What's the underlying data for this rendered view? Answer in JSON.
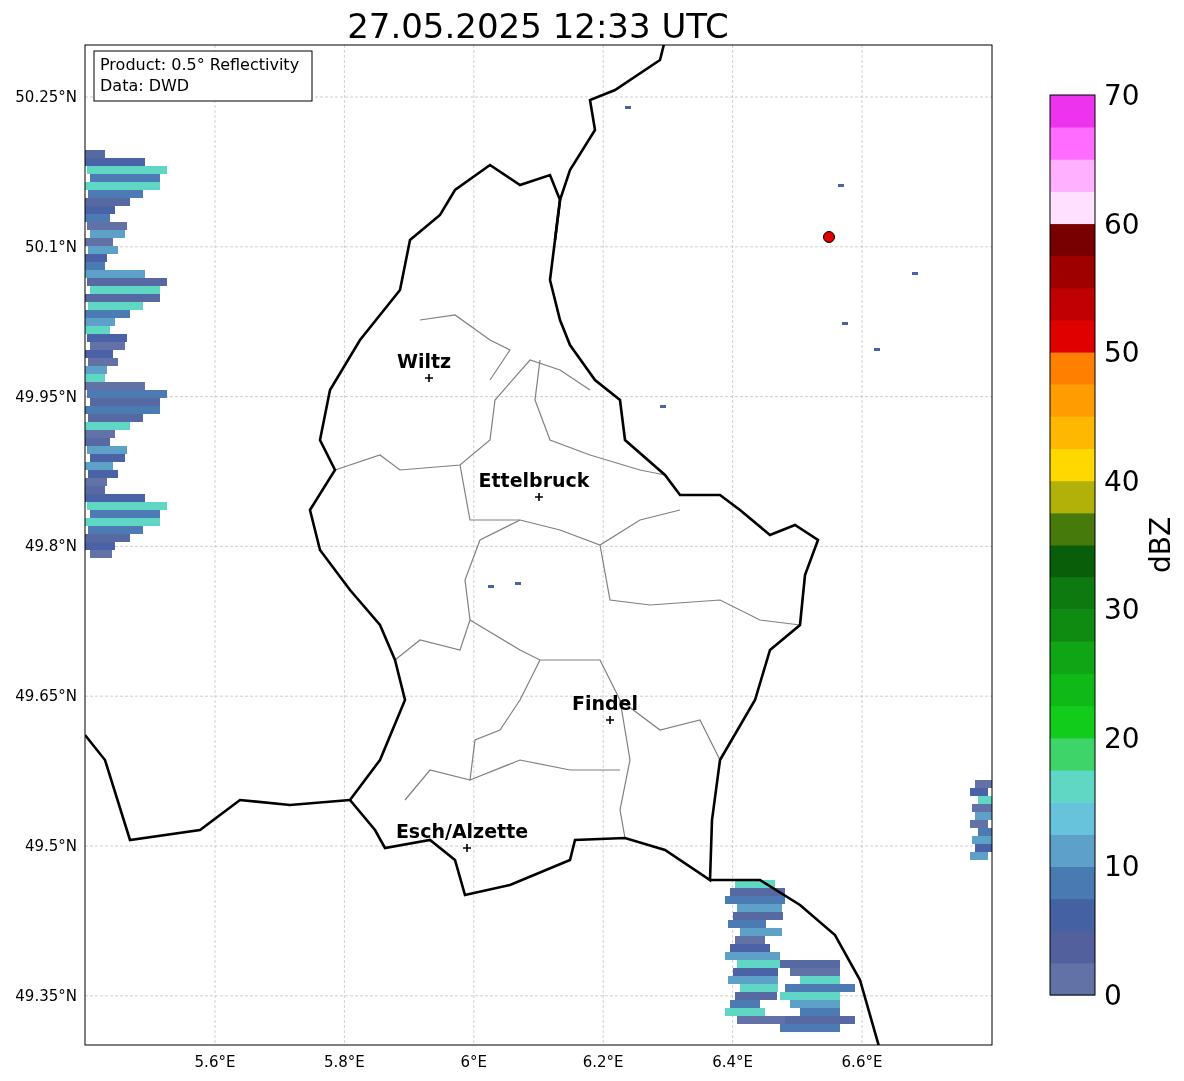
{
  "title": "27.05.2025 12:33 UTC",
  "info_box": {
    "lines": [
      "Product: 0.5° Reflectivity",
      "Data: DWD"
    ]
  },
  "y_ticks": [
    "50.25°N",
    "50.1°N",
    "49.95°N",
    "49.8°N",
    "49.65°N",
    "49.5°N",
    "49.35°N"
  ],
  "x_ticks": [
    "5.6°E",
    "5.8°E",
    "6°E",
    "6.2°E",
    "6.4°E",
    "6.6°E"
  ],
  "cities": [
    "Wiltz",
    "Ettelbruck",
    "Findel",
    "Esch/Alzette"
  ],
  "colorbar": {
    "label": "dBZ",
    "ticks": [
      "70",
      "60",
      "50",
      "40",
      "30",
      "20",
      "10",
      "0"
    ],
    "segments": [
      {
        "color": "#6372a6"
      },
      {
        "color": "#52619e"
      },
      {
        "color": "#4462a3"
      },
      {
        "color": "#4a7ab2"
      },
      {
        "color": "#5da0c8"
      },
      {
        "color": "#67c3db"
      },
      {
        "color": "#5fd7c4"
      },
      {
        "color": "#3dd46a"
      },
      {
        "color": "#12cc1b"
      },
      {
        "color": "#10ba16"
      },
      {
        "color": "#0fa514"
      },
      {
        "color": "#0e8c12"
      },
      {
        "color": "#0c7a0f"
      },
      {
        "color": "#095e0a"
      },
      {
        "color": "#467a0a"
      },
      {
        "color": "#b1b10a"
      },
      {
        "color": "#ffd800"
      },
      {
        "color": "#ffb800"
      },
      {
        "color": "#ff9d00"
      },
      {
        "color": "#ff7f00"
      },
      {
        "color": "#e00000"
      },
      {
        "color": "#c00000"
      },
      {
        "color": "#9e0000"
      },
      {
        "color": "#780000"
      },
      {
        "color": "#ffe0ff"
      },
      {
        "color": "#ffb0ff"
      },
      {
        "color": "#ff6cff"
      },
      {
        "color": "#ee33ee"
      }
    ]
  }
}
